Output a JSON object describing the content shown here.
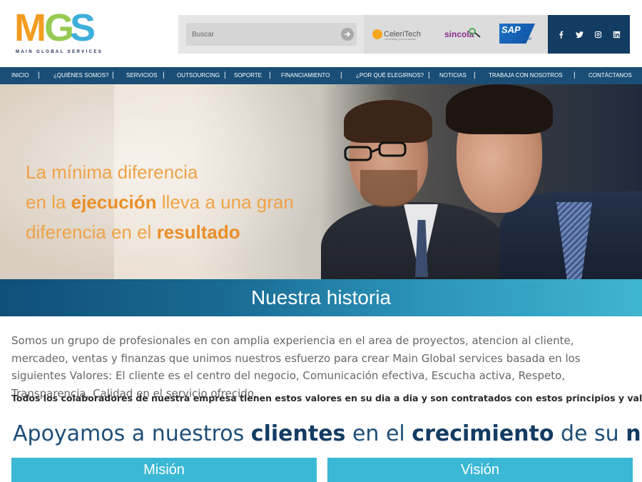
{
  "brand": {
    "logo_m": "M",
    "logo_g": "G",
    "logo_s": "S",
    "tagline": "MAIN GLOBAL SERVICES",
    "colors": {
      "orange": "#f39c1f",
      "green": "#8bc540",
      "blue": "#2aa7d8",
      "navy": "#133c63"
    }
  },
  "search": {
    "placeholder": "Buscar",
    "button_icon": "arrow-right-icon"
  },
  "partners": {
    "celeritech": "CeleriTech",
    "celeritech_sub": "innovating your business",
    "sincola": "sincola",
    "sap": "SAP",
    "sap_partner": "Partner"
  },
  "social": [
    "facebook-icon",
    "twitter-icon",
    "instagram-icon",
    "linkedin-icon"
  ],
  "nav": {
    "items": [
      "INICIO",
      "¿QUIÉNES SOMOS?",
      "SERVICIOS",
      "OUTSOURCING",
      "SOPORTE",
      "FINANCIAMIENTO",
      "¿POR QUÉ ELEGIRNOS?",
      "NOTICIAS",
      "TRABAJA CON NOSOTROS",
      "CONTÁCTANOS"
    ],
    "separator": "|"
  },
  "hero": {
    "line1": "La mínima diferencia",
    "line2_pre": "en la ",
    "line2_bold": "ejecución",
    "line2_post": " lleva a una gran",
    "line3_pre": "diferencia en el ",
    "line3_bold": "resultado"
  },
  "banner": {
    "title": "Nuestra historia"
  },
  "content": {
    "intro": "Somos un grupo de profesionales en con amplia experiencia en el area de proyectos, atencion al cliente,  mercadeo, ventas y finanzas que unimos nuestros esfuerzo para crear Main Global services basada en los siguientes Valores:  El cliente es el centro del negocio, Comunicación efectiva, Escucha activa, Respeto, Transparencia, Calidad en el servicio ofrecido.",
    "values": "Todos los colaboradores de nuestra empresa tienen estos valores en su dia a dia y son contratados con estos principios y valores.",
    "slogan_1": "Apoyamos",
    "slogan_2": " a nuestros ",
    "slogan_3": "clientes",
    "slogan_4": " en el ",
    "slogan_5": "crecimiento",
    "slogan_6": " de su ",
    "slogan_7": "negocio."
  },
  "tabs": {
    "mision": "Misión",
    "vision": "Visión"
  }
}
